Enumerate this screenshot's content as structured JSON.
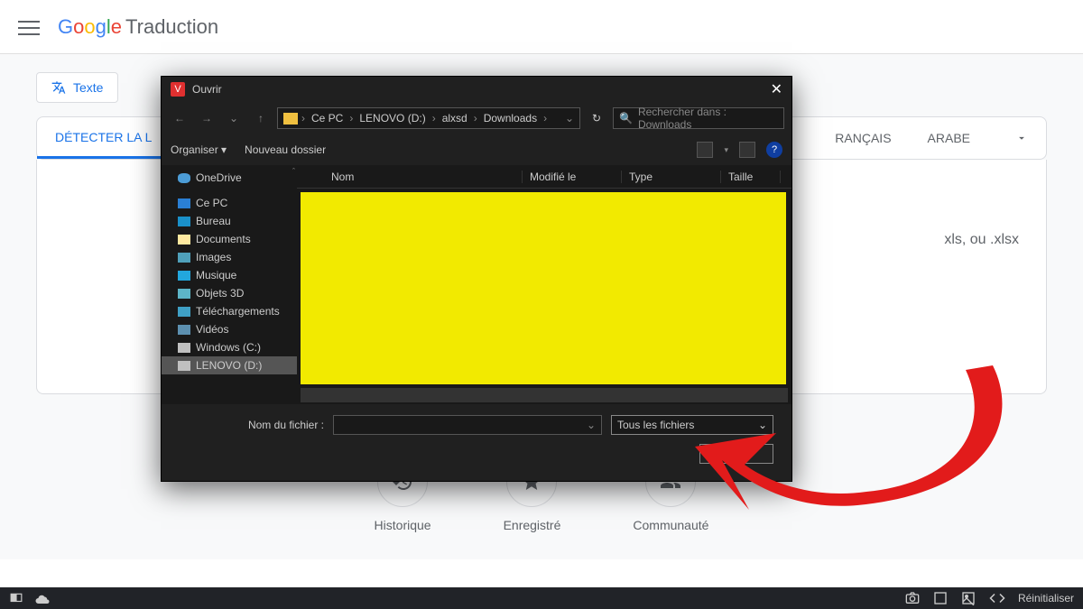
{
  "header": {
    "app_name_suffix": "Traduction"
  },
  "toolbar": {
    "texte_label": "Texte"
  },
  "langTabs": {
    "detect": "DÉTECTER LA L",
    "francais": "RANÇAIS",
    "arabe": "ARABE"
  },
  "hint": "xls, ou .xlsx",
  "bottom": {
    "historique": "Historique",
    "enregistre": "Enregistré",
    "communaute": "Communauté"
  },
  "dialog": {
    "title": "Ouvrir",
    "breadcrumb": [
      "Ce PC",
      "LENOVO (D:)",
      "alxsd",
      "Downloads"
    ],
    "search_placeholder": "Rechercher dans : Downloads",
    "organiser": "Organiser",
    "nouveau_dossier": "Nouveau dossier",
    "columns": {
      "nom": "Nom",
      "modifie": "Modifié le",
      "type": "Type",
      "taille": "Taille"
    },
    "sidebar": {
      "onedrive": "OneDrive",
      "cepc": "Ce PC",
      "bureau": "Bureau",
      "documents": "Documents",
      "images": "Images",
      "musique": "Musique",
      "objets3d": "Objets 3D",
      "telechargements": "Téléchargements",
      "videos": "Vidéos",
      "windowsc": "Windows (C:)",
      "lenovod": "LENOVO (D:)"
    },
    "filename_label": "Nom du fichier :",
    "filetype_value": "Tous les fichiers",
    "open_btn": "Ouvrir"
  },
  "taskbar": {
    "reset": "Réinitialiser"
  }
}
